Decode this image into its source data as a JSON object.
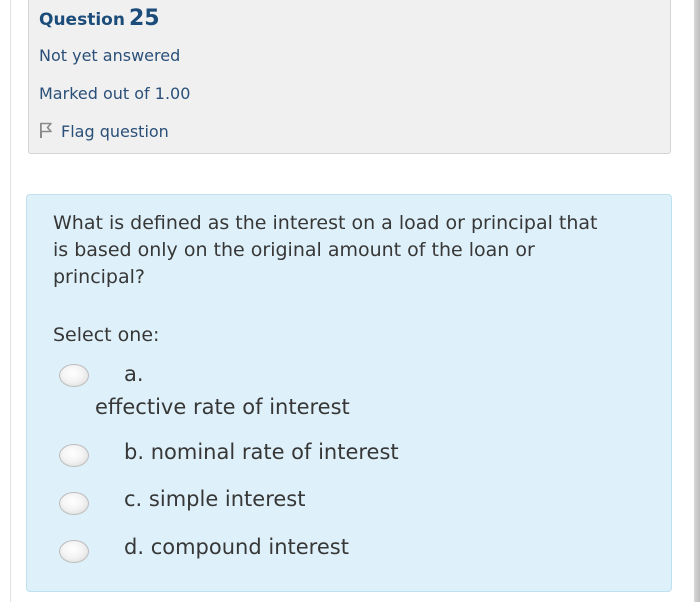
{
  "info": {
    "question_word": "Question",
    "question_number": "25",
    "state": "Not yet answered",
    "grade": "Marked out of 1.00",
    "flag_label": "Flag question"
  },
  "question": {
    "text": "What is defined as the interest on a load or principal that is based only on the original amount of the loan or principal?",
    "prompt": "Select one:",
    "options": [
      {
        "letter": "a.",
        "text": "effective rate of interest"
      },
      {
        "letter": "b.",
        "text": "nominal rate of interest"
      },
      {
        "letter": "c.",
        "text": "simple interest"
      },
      {
        "letter": "d.",
        "text": "compound interest"
      }
    ],
    "selected": null
  },
  "colors": {
    "info_background": "#f0f0f0",
    "question_background": "#def0f9",
    "heading_text": "#1c4d7a",
    "body_text": "#373737"
  },
  "icons": {
    "flag": "flag-icon",
    "radio": "radio-button"
  }
}
